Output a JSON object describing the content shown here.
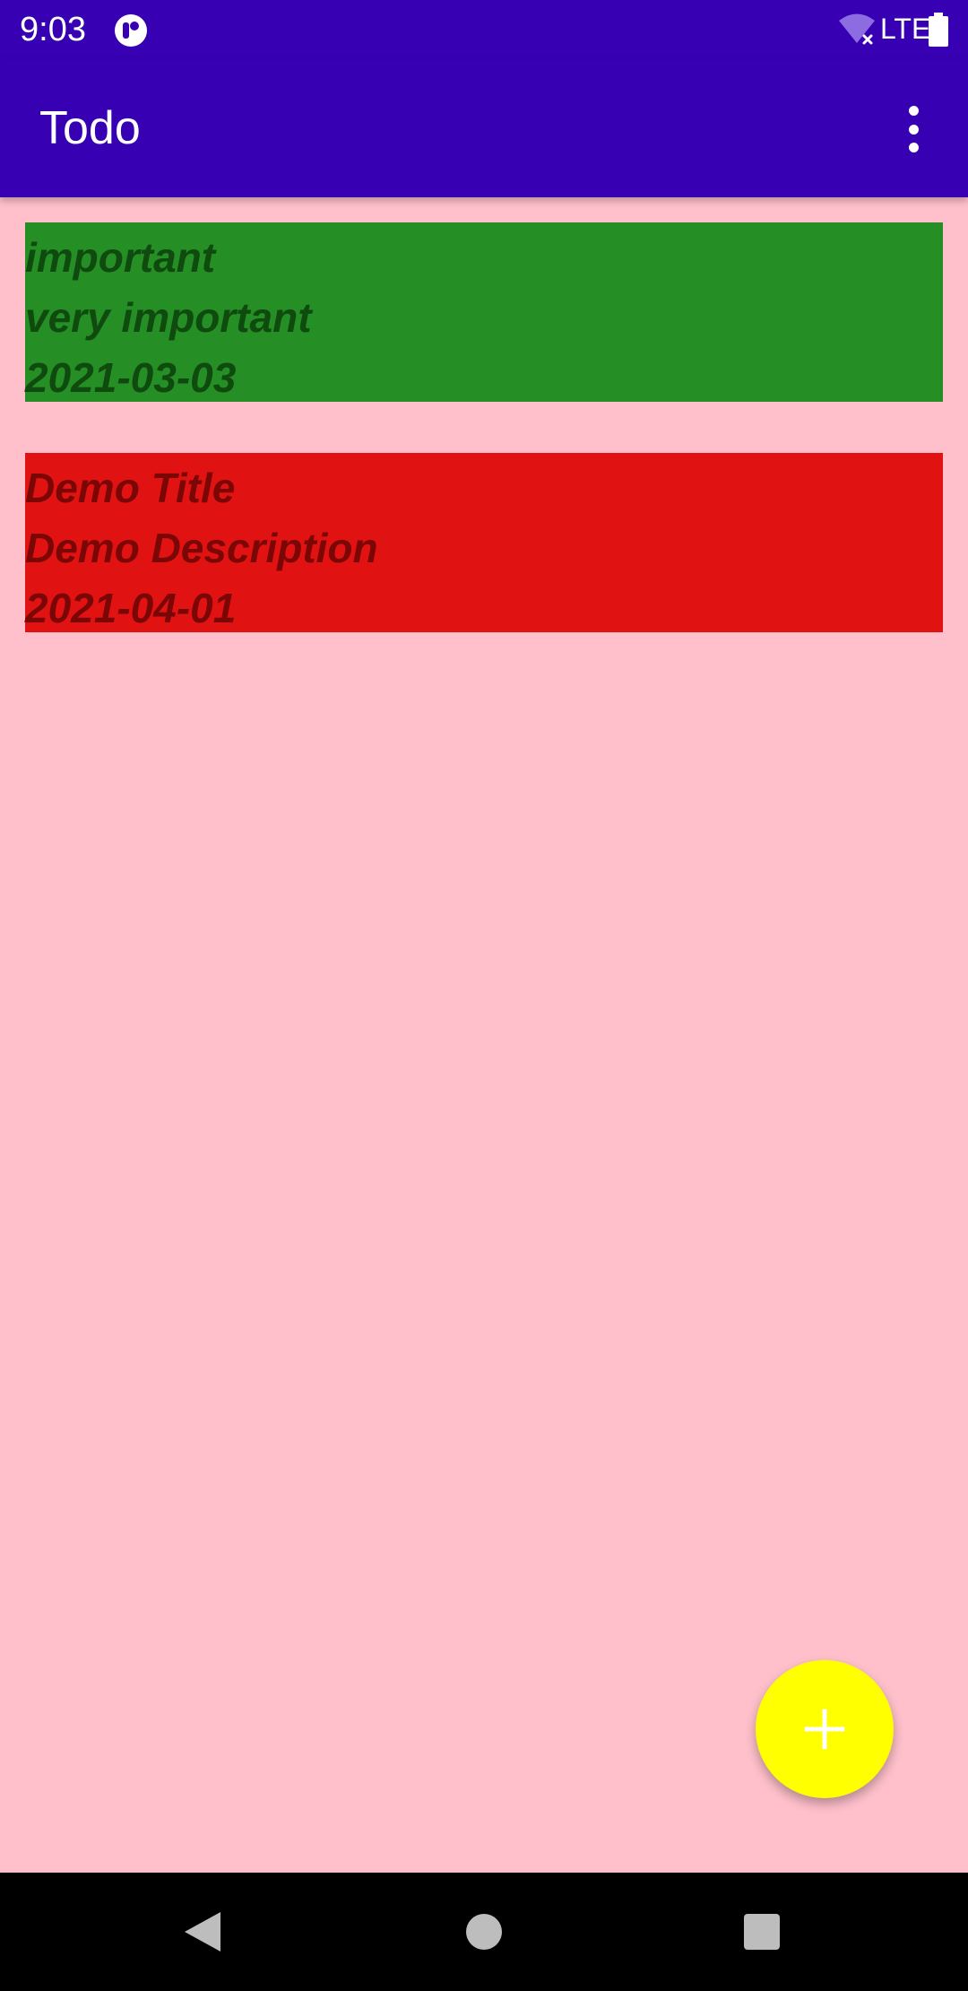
{
  "status_bar": {
    "time": "9:03",
    "network": "LTE",
    "icons": [
      "app-notification-icon",
      "wifi-off-icon",
      "battery-icon"
    ]
  },
  "app_bar": {
    "title": "Todo",
    "menu_icon": "more-vert-icon"
  },
  "todos": [
    {
      "title": "important",
      "description": "very important",
      "date": "2021-03-03",
      "background_color": "#258E25",
      "text_color": "#0F4A0F"
    },
    {
      "title": "Demo Title",
      "description": "Demo Description",
      "date": "2021-04-01",
      "background_color": "#E11212",
      "text_color": "#7A0606"
    }
  ],
  "fab": {
    "icon": "add-icon",
    "color": "#FFFF00"
  },
  "nav_bar": {
    "icons": [
      "back-icon",
      "home-icon",
      "recents-icon"
    ]
  },
  "colors": {
    "primary": "#3700B3",
    "background": "#FFC0CB"
  }
}
